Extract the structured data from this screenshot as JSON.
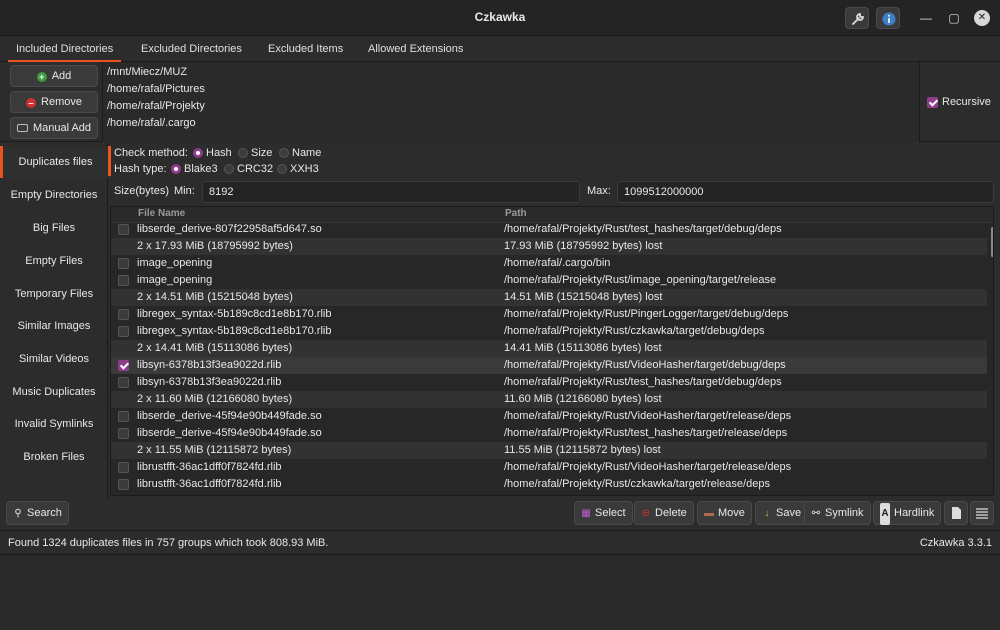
{
  "window": {
    "title": "Czkawka"
  },
  "tabs": [
    {
      "label": "Included Directories",
      "active": true
    },
    {
      "label": "Excluded Directories",
      "active": false
    },
    {
      "label": "Excluded Items",
      "active": false
    },
    {
      "label": "Allowed Extensions",
      "active": false
    }
  ],
  "dir_buttons": {
    "add": "Add",
    "remove": "Remove",
    "manual_add": "Manual Add"
  },
  "directories": [
    "/mnt/Miecz/MUZ",
    "/home/rafal/Pictures",
    "/home/rafal/Projekty",
    "/home/rafal/.cargo"
  ],
  "recursive": {
    "label": "Recursive",
    "checked": true
  },
  "nav": [
    {
      "label": "Duplicates files",
      "active": true
    },
    {
      "label": "Empty Directories",
      "active": false
    },
    {
      "label": "Big Files",
      "active": false
    },
    {
      "label": "Empty Files",
      "active": false
    },
    {
      "label": "Temporary Files",
      "active": false
    },
    {
      "label": "Similar Images",
      "active": false
    },
    {
      "label": "Similar Videos",
      "active": false
    },
    {
      "label": "Music Duplicates",
      "active": false
    },
    {
      "label": "Invalid Symlinks",
      "active": false
    },
    {
      "label": "Broken Files",
      "active": false
    }
  ],
  "options": {
    "check_method_label": "Check method:",
    "check_methods": [
      {
        "label": "Hash",
        "selected": true
      },
      {
        "label": "Size",
        "selected": false
      },
      {
        "label": "Name",
        "selected": false
      }
    ],
    "hash_type_label": "Hash type:",
    "hash_types": [
      {
        "label": "Blake3",
        "selected": true
      },
      {
        "label": "CRC32",
        "selected": false
      },
      {
        "label": "XXH3",
        "selected": false
      }
    ],
    "size_label": "Size(bytes)",
    "min_label": "Min:",
    "min_value": "8192",
    "max_label": "Max:",
    "max_value": "1099512000000"
  },
  "table": {
    "headers": {
      "file_name": "File Name",
      "path": "Path"
    },
    "rows": [
      {
        "name": "libserde_derive-807f22958af5d647.so",
        "path": "/home/rafal/Projekty/Rust/test_hashes/target/debug/deps",
        "header": false,
        "checked": false
      },
      {
        "name": "2 x 17.93 MiB (18795992 bytes)",
        "path": "17.93 MiB (18795992 bytes) lost",
        "header": true,
        "checked": false
      },
      {
        "name": "image_opening",
        "path": "/home/rafal/.cargo/bin",
        "header": false,
        "checked": false
      },
      {
        "name": "image_opening",
        "path": "/home/rafal/Projekty/Rust/image_opening/target/release",
        "header": false,
        "checked": false
      },
      {
        "name": "2 x 14.51 MiB (15215048 bytes)",
        "path": "14.51 MiB (15215048 bytes) lost",
        "header": true,
        "checked": false
      },
      {
        "name": "libregex_syntax-5b189c8cd1e8b170.rlib",
        "path": "/home/rafal/Projekty/Rust/PingerLogger/target/debug/deps",
        "header": false,
        "checked": false
      },
      {
        "name": "libregex_syntax-5b189c8cd1e8b170.rlib",
        "path": "/home/rafal/Projekty/Rust/czkawka/target/debug/deps",
        "header": false,
        "checked": false
      },
      {
        "name": "2 x 14.41 MiB (15113086 bytes)",
        "path": "14.41 MiB (15113086 bytes) lost",
        "header": true,
        "checked": false
      },
      {
        "name": "libsyn-6378b13f3ea9022d.rlib",
        "path": "/home/rafal/Projekty/Rust/VideoHasher/target/debug/deps",
        "header": false,
        "checked": true
      },
      {
        "name": "libsyn-6378b13f3ea9022d.rlib",
        "path": "/home/rafal/Projekty/Rust/test_hashes/target/debug/deps",
        "header": false,
        "checked": false
      },
      {
        "name": "2 x 11.60 MiB (12166080 bytes)",
        "path": "11.60 MiB (12166080 bytes) lost",
        "header": true,
        "checked": false
      },
      {
        "name": "libserde_derive-45f94e90b449fade.so",
        "path": "/home/rafal/Projekty/Rust/VideoHasher/target/release/deps",
        "header": false,
        "checked": false
      },
      {
        "name": "libserde_derive-45f94e90b449fade.so",
        "path": "/home/rafal/Projekty/Rust/test_hashes/target/release/deps",
        "header": false,
        "checked": false
      },
      {
        "name": "2 x 11.55 MiB (12115872 bytes)",
        "path": "11.55 MiB (12115872 bytes) lost",
        "header": true,
        "checked": false
      },
      {
        "name": "librustfft-36ac1dff0f7824fd.rlib",
        "path": "/home/rafal/Projekty/Rust/VideoHasher/target/release/deps",
        "header": false,
        "checked": false
      },
      {
        "name": "librustfft-36ac1dff0f7824fd.rlib",
        "path": "/home/rafal/Projekty/Rust/czkawka/target/release/deps",
        "header": false,
        "checked": false
      }
    ]
  },
  "actions": {
    "search": "Search",
    "select": "Select",
    "delete": "Delete",
    "move": "Move",
    "save": "Save",
    "symlink": "Symlink",
    "hardlink": "Hardlink"
  },
  "status": {
    "message": "Found 1324 duplicates files in 757 groups which took 808.93 MiB.",
    "version": "Czkawka 3.3.1"
  },
  "colors": {
    "accent": "#e95420",
    "check": "#8e3c8c",
    "add_icon": "#3e9a3e",
    "remove_icon": "#d03030"
  }
}
